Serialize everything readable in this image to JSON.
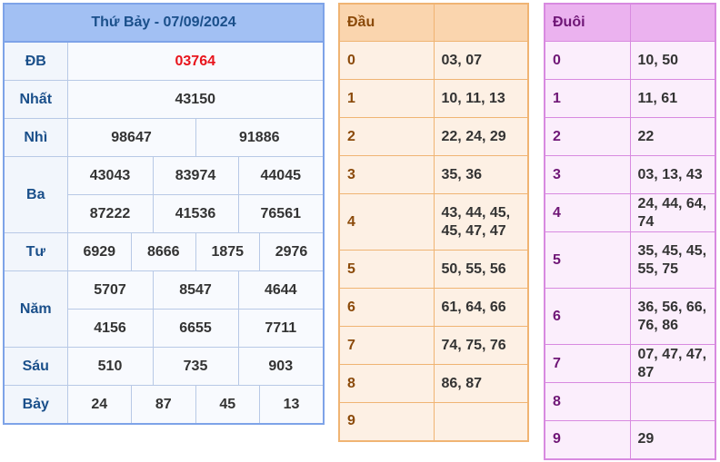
{
  "header": {
    "title": "Thứ Bảy - 07/09/2024"
  },
  "prizes": {
    "db": {
      "label": "ĐB",
      "values": [
        "03764"
      ]
    },
    "nhat": {
      "label": "Nhất",
      "values": [
        "43150"
      ]
    },
    "nhi": {
      "label": "Nhì",
      "values": [
        "98647",
        "91886"
      ]
    },
    "ba": {
      "label": "Ba",
      "values": [
        "43043",
        "83974",
        "44045",
        "87222",
        "41536",
        "76561"
      ]
    },
    "tu": {
      "label": "Tư",
      "values": [
        "6929",
        "8666",
        "1875",
        "2976"
      ]
    },
    "nam": {
      "label": "Năm",
      "values": [
        "5707",
        "8547",
        "4644",
        "4156",
        "6655",
        "7711"
      ]
    },
    "sau": {
      "label": "Sáu",
      "values": [
        "510",
        "735",
        "903"
      ]
    },
    "bay": {
      "label": "Bảy",
      "values": [
        "24",
        "87",
        "45",
        "13"
      ]
    }
  },
  "dau": {
    "header": "Đầu",
    "rows": [
      {
        "k": "0",
        "v": "03, 07"
      },
      {
        "k": "1",
        "v": "10, 11, 13"
      },
      {
        "k": "2",
        "v": "22, 24, 29"
      },
      {
        "k": "3",
        "v": "35, 36"
      },
      {
        "k": "4",
        "v": "43, 44, 45, 45, 47, 47"
      },
      {
        "k": "5",
        "v": "50, 55, 56"
      },
      {
        "k": "6",
        "v": "61, 64, 66"
      },
      {
        "k": "7",
        "v": "74, 75, 76"
      },
      {
        "k": "8",
        "v": "86, 87"
      },
      {
        "k": "9",
        "v": ""
      }
    ]
  },
  "duoi": {
    "header": "Đuôi",
    "rows": [
      {
        "k": "0",
        "v": "10, 50"
      },
      {
        "k": "1",
        "v": "11, 61"
      },
      {
        "k": "2",
        "v": "22"
      },
      {
        "k": "3",
        "v": "03, 13, 43"
      },
      {
        "k": "4",
        "v": "24, 44, 64, 74"
      },
      {
        "k": "5",
        "v": "35, 45, 45, 55, 75"
      },
      {
        "k": "6",
        "v": "36, 56, 66, 76, 86"
      },
      {
        "k": "7",
        "v": "07, 47, 47, 87"
      },
      {
        "k": "8",
        "v": ""
      },
      {
        "k": "9",
        "v": "29"
      }
    ]
  },
  "colors": {
    "special_prize": "#e8141c",
    "results_header": "#a2c0f3",
    "dau_header": "#fad5ae",
    "duoi_header": "#ebb2ef"
  }
}
